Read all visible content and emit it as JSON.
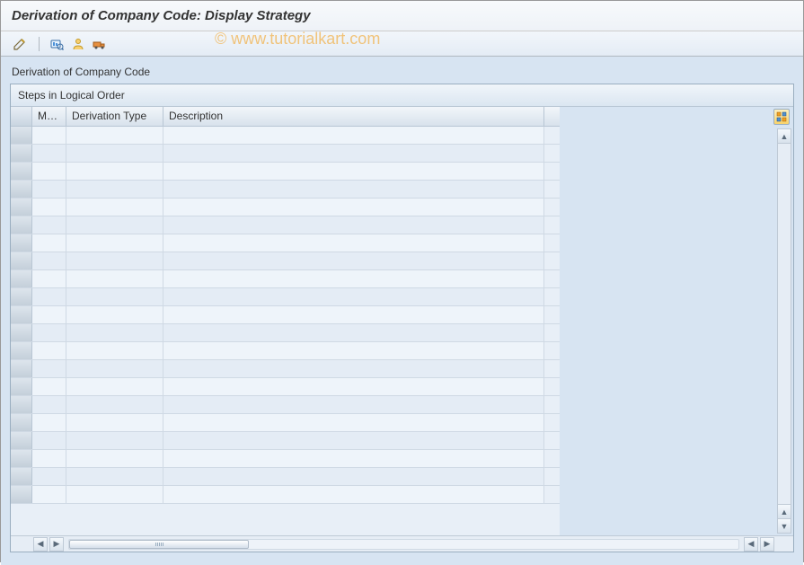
{
  "title": "Derivation of Company Code: Display Strategy",
  "watermark": "© www.tutorialkart.com",
  "toolbar": {
    "icons": [
      "change-icon",
      "analyze-icon",
      "user-icon",
      "transport-icon"
    ]
  },
  "section_label": "Derivation of Company Code",
  "panel": {
    "header": "Steps in Logical Order",
    "columns": {
      "ma": "Ma...",
      "derivation_type": "Derivation Type",
      "description": "Description"
    },
    "rows": [
      {
        "ma": "",
        "dt": "",
        "desc": ""
      },
      {
        "ma": "",
        "dt": "",
        "desc": ""
      },
      {
        "ma": "",
        "dt": "",
        "desc": ""
      },
      {
        "ma": "",
        "dt": "",
        "desc": ""
      },
      {
        "ma": "",
        "dt": "",
        "desc": ""
      },
      {
        "ma": "",
        "dt": "",
        "desc": ""
      },
      {
        "ma": "",
        "dt": "",
        "desc": ""
      },
      {
        "ma": "",
        "dt": "",
        "desc": ""
      },
      {
        "ma": "",
        "dt": "",
        "desc": ""
      },
      {
        "ma": "",
        "dt": "",
        "desc": ""
      },
      {
        "ma": "",
        "dt": "",
        "desc": ""
      },
      {
        "ma": "",
        "dt": "",
        "desc": ""
      },
      {
        "ma": "",
        "dt": "",
        "desc": ""
      },
      {
        "ma": "",
        "dt": "",
        "desc": ""
      },
      {
        "ma": "",
        "dt": "",
        "desc": ""
      },
      {
        "ma": "",
        "dt": "",
        "desc": ""
      },
      {
        "ma": "",
        "dt": "",
        "desc": ""
      },
      {
        "ma": "",
        "dt": "",
        "desc": ""
      },
      {
        "ma": "",
        "dt": "",
        "desc": ""
      },
      {
        "ma": "",
        "dt": "",
        "desc": ""
      },
      {
        "ma": "",
        "dt": "",
        "desc": ""
      }
    ]
  }
}
